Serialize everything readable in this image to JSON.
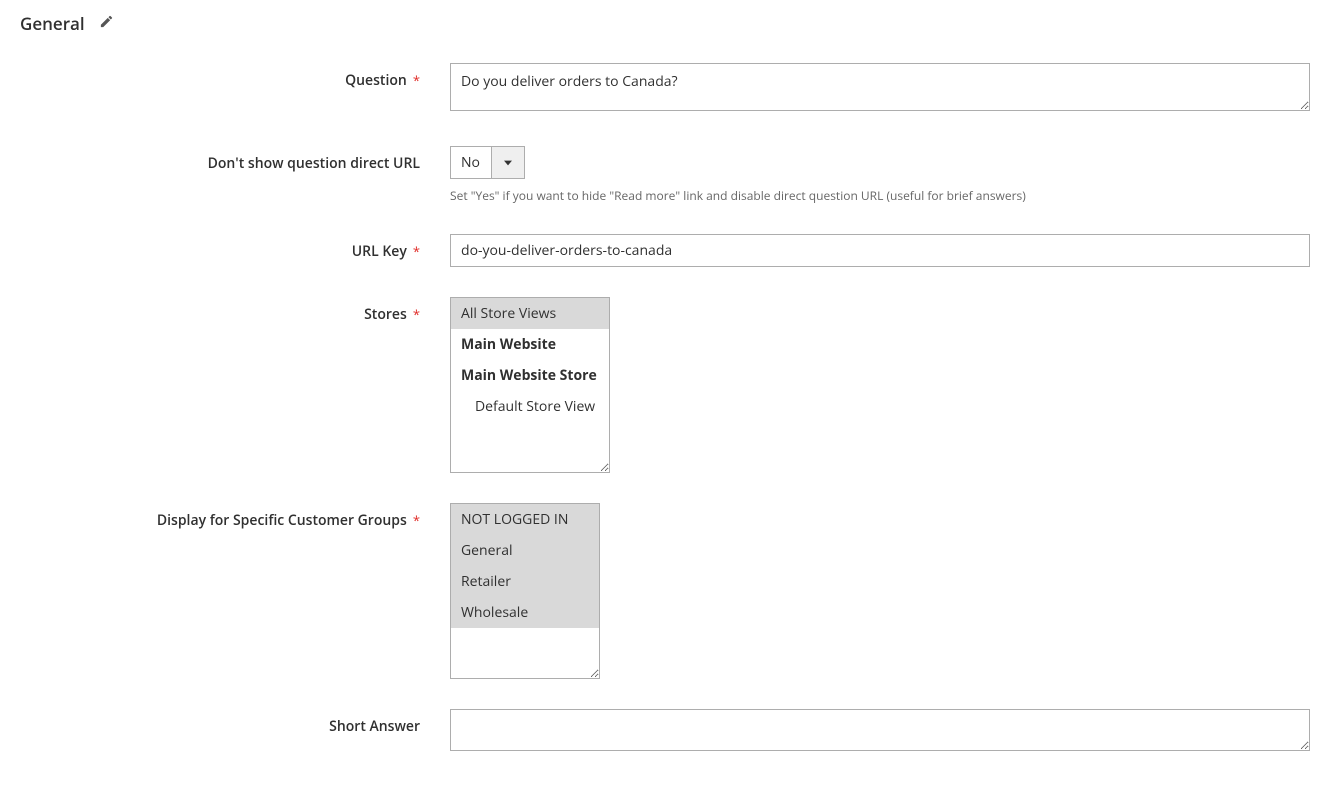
{
  "section": {
    "title": "General"
  },
  "fields": {
    "question": {
      "label": "Question",
      "value": "Do you deliver orders to Canada?"
    },
    "hide_url": {
      "label": "Don't show question direct URL",
      "value": "No",
      "note": "Set \"Yes\" if you want to hide \"Read more\" link and disable direct question URL (useful for brief answers)"
    },
    "url_key": {
      "label": "URL Key",
      "value": "do-you-deliver-orders-to-canada"
    },
    "stores": {
      "label": "Stores",
      "options": {
        "all": "All Store Views",
        "main_site": "Main Website",
        "main_store": "Main Website Store",
        "default_view": "Default Store View"
      }
    },
    "customer_groups": {
      "label": "Display for Specific Customer Groups",
      "options": {
        "not_logged_in": "NOT LOGGED IN",
        "general": "General",
        "retailer": "Retailer",
        "wholesale": "Wholesale"
      }
    },
    "short_answer": {
      "label": "Short Answer",
      "value": ""
    }
  }
}
